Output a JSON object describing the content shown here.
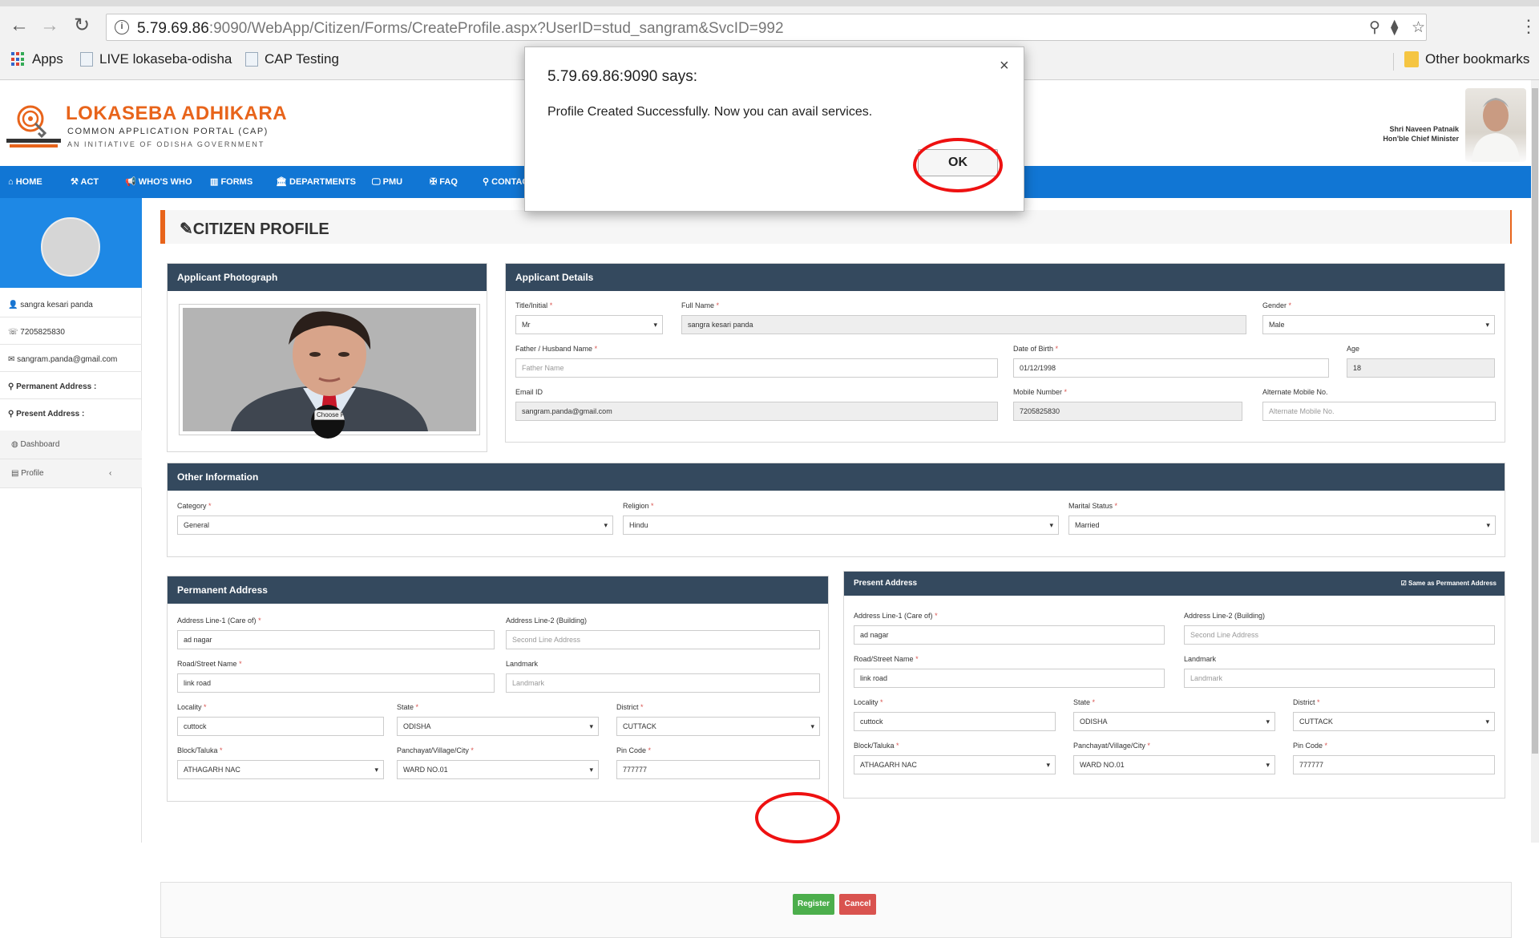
{
  "browser": {
    "url_host": "5.79.69.86",
    "url_rest": ":9090/WebApp/Citizen/Forms/CreateProfile.aspx?UserID=stud_sangram&SvcID=992",
    "bookmarks": [
      "Apps",
      "LIVE lokaseba-odisha",
      "CAP Testing"
    ],
    "other_bookmarks": "Other bookmarks"
  },
  "header": {
    "brand_title": "LOKASEBA ADHIKARA",
    "brand_subtitle": "COMMON APPLICATION PORTAL (CAP)",
    "brand_tagline": "AN INITIATIVE OF ODISHA GOVERNMENT",
    "cm_name": "Shri Naveen Patnaik",
    "cm_title": "Hon'ble Chief Minister"
  },
  "nav": [
    {
      "label": "HOME",
      "icon": "home-icon"
    },
    {
      "label": "ACT",
      "icon": "gavel-icon"
    },
    {
      "label": "WHO'S WHO",
      "icon": "bullhorn-icon"
    },
    {
      "label": "FORMS",
      "icon": "book-icon"
    },
    {
      "label": "DEPARTMENTS",
      "icon": "bank-icon"
    },
    {
      "label": "PMU",
      "icon": "desktop-icon"
    },
    {
      "label": "FAQ",
      "icon": "question-icon"
    },
    {
      "label": "CONTAC",
      "icon": "map-marker-icon"
    }
  ],
  "sidebar": {
    "name": "sangra kesari panda",
    "phone": "7205825830",
    "email": "sangram.panda@gmail.com",
    "permanent_address_label": "Permanent Address :",
    "present_address_label": "Present Address :",
    "menu": [
      "Dashboard",
      "Profile"
    ]
  },
  "page_title": "CITIZEN PROFILE",
  "photo_panel": {
    "title": "Applicant Photograph",
    "choose_label": "Choose F"
  },
  "applicant": {
    "title": "Applicant Details",
    "title_label": "Title/Initial",
    "title_value": "Mr",
    "fullname_label": "Full Name",
    "fullname_value": "sangra kesari panda",
    "gender_label": "Gender",
    "gender_value": "Male",
    "father_label": "Father / Husband Name",
    "father_placeholder": "Father Name",
    "dob_label": "Date of Birth",
    "dob_value": "01/12/1998",
    "age_label": "Age",
    "age_value": "18",
    "email_label": "Email ID",
    "email_value": "sangram.panda@gmail.com",
    "mobile_label": "Mobile Number",
    "mobile_value": "7205825830",
    "alt_mobile_label": "Alternate Mobile No.",
    "alt_mobile_placeholder": "Alternate Mobile No."
  },
  "other_info": {
    "title": "Other Information",
    "category_label": "Category",
    "category_value": "General",
    "religion_label": "Religion",
    "religion_value": "Hindu",
    "marital_label": "Marital Status",
    "marital_value": "Married"
  },
  "permanent": {
    "title": "Permanent Address",
    "line1_label": "Address Line-1 (Care of)",
    "line1_value": "ad nagar",
    "line2_label": "Address Line-2 (Building)",
    "line2_placeholder": "Second Line Address",
    "road_label": "Road/Street Name",
    "road_value": "link road",
    "landmark_label": "Landmark",
    "landmark_placeholder": "Landmark",
    "locality_label": "Locality",
    "locality_value": "cuttock",
    "state_label": "State",
    "state_value": "ODISHA",
    "district_label": "District",
    "district_value": "CUTTACK",
    "block_label": "Block/Taluka",
    "block_value": "ATHAGARH NAC",
    "panchayat_label": "Panchayat/Village/City",
    "panchayat_value": "WARD NO.01",
    "pin_label": "Pin Code",
    "pin_value": "777777"
  },
  "present": {
    "title": "Present Address",
    "same_label": "Same as Permanent Address",
    "line1_label": "Address Line-1 (Care of)",
    "line1_value": "ad nagar",
    "line2_label": "Address Line-2 (Building)",
    "line2_placeholder": "Second Line Address",
    "road_label": "Road/Street Name",
    "road_value": "link road",
    "landmark_label": "Landmark",
    "landmark_placeholder": "Landmark",
    "locality_label": "Locality",
    "locality_value": "cuttock",
    "state_label": "State",
    "state_value": "ODISHA",
    "district_label": "District",
    "district_value": "CUTTACK",
    "block_label": "Block/Taluka",
    "block_value": "ATHAGARH NAC",
    "panchayat_label": "Panchayat/Village/City",
    "panchayat_value": "WARD NO.01",
    "pin_label": "Pin Code",
    "pin_value": "777777"
  },
  "buttons": {
    "register": "Register",
    "cancel": "Cancel"
  },
  "dialog": {
    "title": "5.79.69.86:9090 says:",
    "message": "Profile Created Successfully. Now you can avail services.",
    "ok": "OK",
    "close": "×"
  },
  "colors": {
    "brand_orange": "#e8641b",
    "nav_blue": "#1176d4",
    "panel_header": "#34495e",
    "register_green": "#4cae4c",
    "cancel_red": "#d9534f",
    "highlight_red": "#ee1111"
  }
}
